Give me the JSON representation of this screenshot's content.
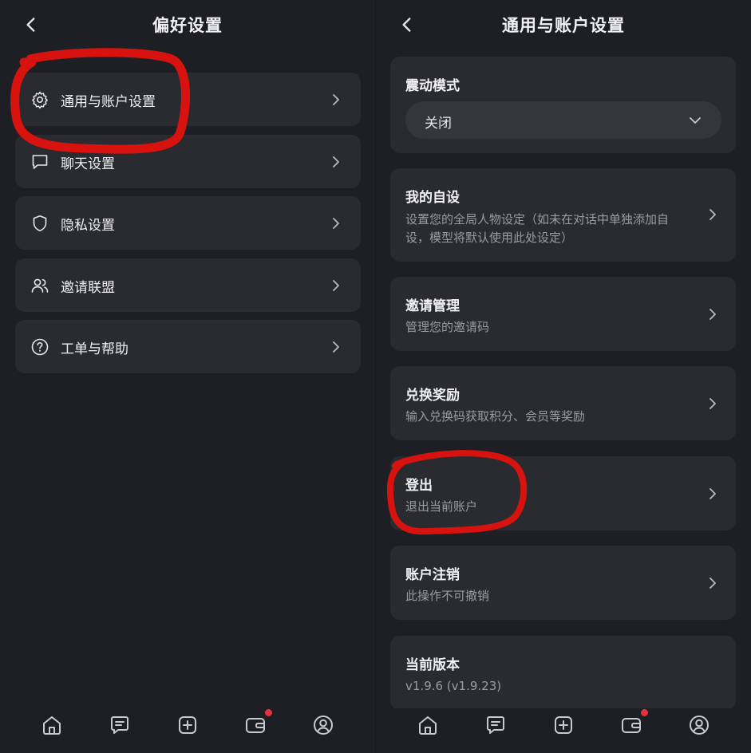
{
  "left_screen": {
    "title": "偏好设置",
    "menu": [
      {
        "label": "通用与账户设置",
        "icon": "gear-icon"
      },
      {
        "label": "聊天设置",
        "icon": "chat-bubble-icon"
      },
      {
        "label": "隐私设置",
        "icon": "shield-icon"
      },
      {
        "label": "邀请联盟",
        "icon": "users-icon"
      },
      {
        "label": "工单与帮助",
        "icon": "help-circle-icon"
      }
    ],
    "tabbar": [
      {
        "name": "home-icon"
      },
      {
        "name": "chat-icon"
      },
      {
        "name": "add-icon"
      },
      {
        "name": "wallet-icon",
        "badge": true
      },
      {
        "name": "profile-icon"
      }
    ]
  },
  "right_screen": {
    "title": "通用与账户设置",
    "vibration": {
      "title": "震动模式",
      "value": "关闭"
    },
    "cards": [
      {
        "title": "我的自设",
        "subtitle_line1": "设置您的全局人物设定（如未在对话中单独添加自",
        "subtitle_line2": "设，模型将默认使用此处设定）"
      },
      {
        "title": "邀请管理",
        "subtitle": "管理您的邀请码"
      },
      {
        "title": "兑换奖励",
        "subtitle": "输入兑换码获取积分、会员等奖励"
      },
      {
        "title": "登出",
        "subtitle": "退出当前账户"
      },
      {
        "title": "账户注销",
        "subtitle": "此操作不可撤销"
      }
    ],
    "version": {
      "title": "当前版本",
      "value": "v1.9.6 (v1.9.23)"
    }
  },
  "colors": {
    "background": "#1e1f24",
    "card": "#2a2b31",
    "select": "#35363d",
    "text_primary": "#f2f2f5",
    "text_secondary": "#9a9ba3",
    "badge": "#e8323a",
    "annotation": "#d8130f"
  }
}
